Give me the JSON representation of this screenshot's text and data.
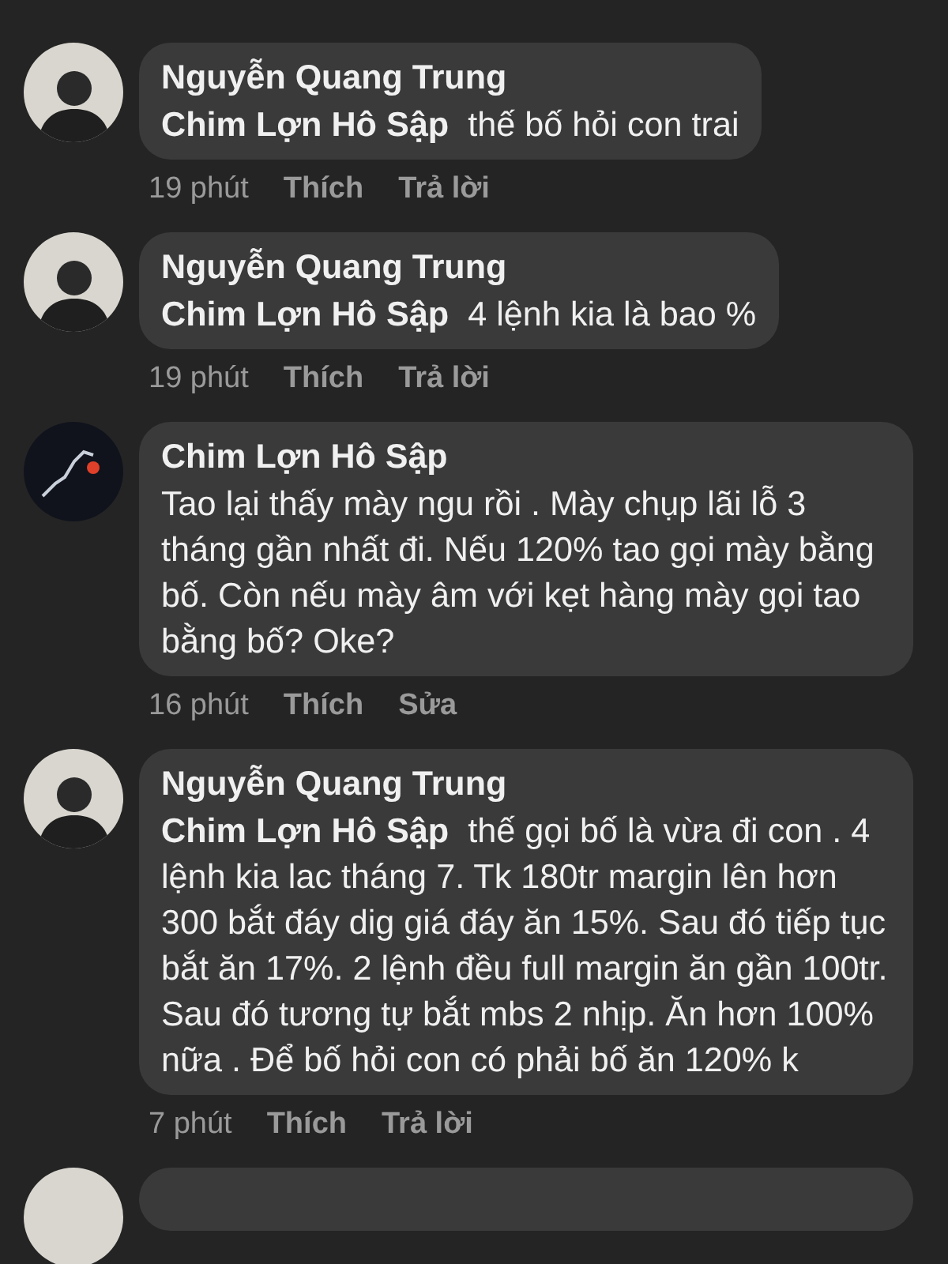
{
  "comments": [
    {
      "kind": "person",
      "author": "Nguyễn Quang Trung",
      "text": "**Chim Lợn Hô Sập**  thế bố hỏi con trai",
      "time": "19 phút",
      "actions": [
        "Thích",
        "Trả lời"
      ]
    },
    {
      "kind": "person",
      "author": "Nguyễn Quang Trung",
      "text": "**Chim Lợn Hô Sập**  4 lệnh kia là bao %",
      "time": "19 phút",
      "actions": [
        "Thích",
        "Trả lời"
      ]
    },
    {
      "kind": "chart",
      "author": "Chim Lợn Hô Sập",
      "text": "Tao lại thấy mày ngu rồi . Mày chụp lãi lỗ 3 tháng gần nhất đi. Nếu 120% tao gọi mày bằng bố. Còn nếu mày âm với kẹt hàng mày gọi tao bằng bố? Oke?",
      "time": "16 phút",
      "actions": [
        "Thích",
        "Sửa"
      ]
    },
    {
      "kind": "person",
      "author": "Nguyễn Quang Trung",
      "text": "**Chim Lợn Hô Sập**  thế gọi bố là vừa đi con . 4 lệnh kia lac tháng 7. Tk 180tr margin lên hơn 300 bắt đáy dig giá đáy ăn 15%. Sau đó tiếp tục bắt ăn 17%. 2 lệnh đều full margin ăn gần 100tr. Sau đó tương tự bắt mbs 2 nhịp. Ăn hơn 100% nữa . Để bố hỏi con có phải bố ăn 120% k",
      "time": "7 phút",
      "actions": [
        "Thích",
        "Trả lời"
      ]
    }
  ]
}
